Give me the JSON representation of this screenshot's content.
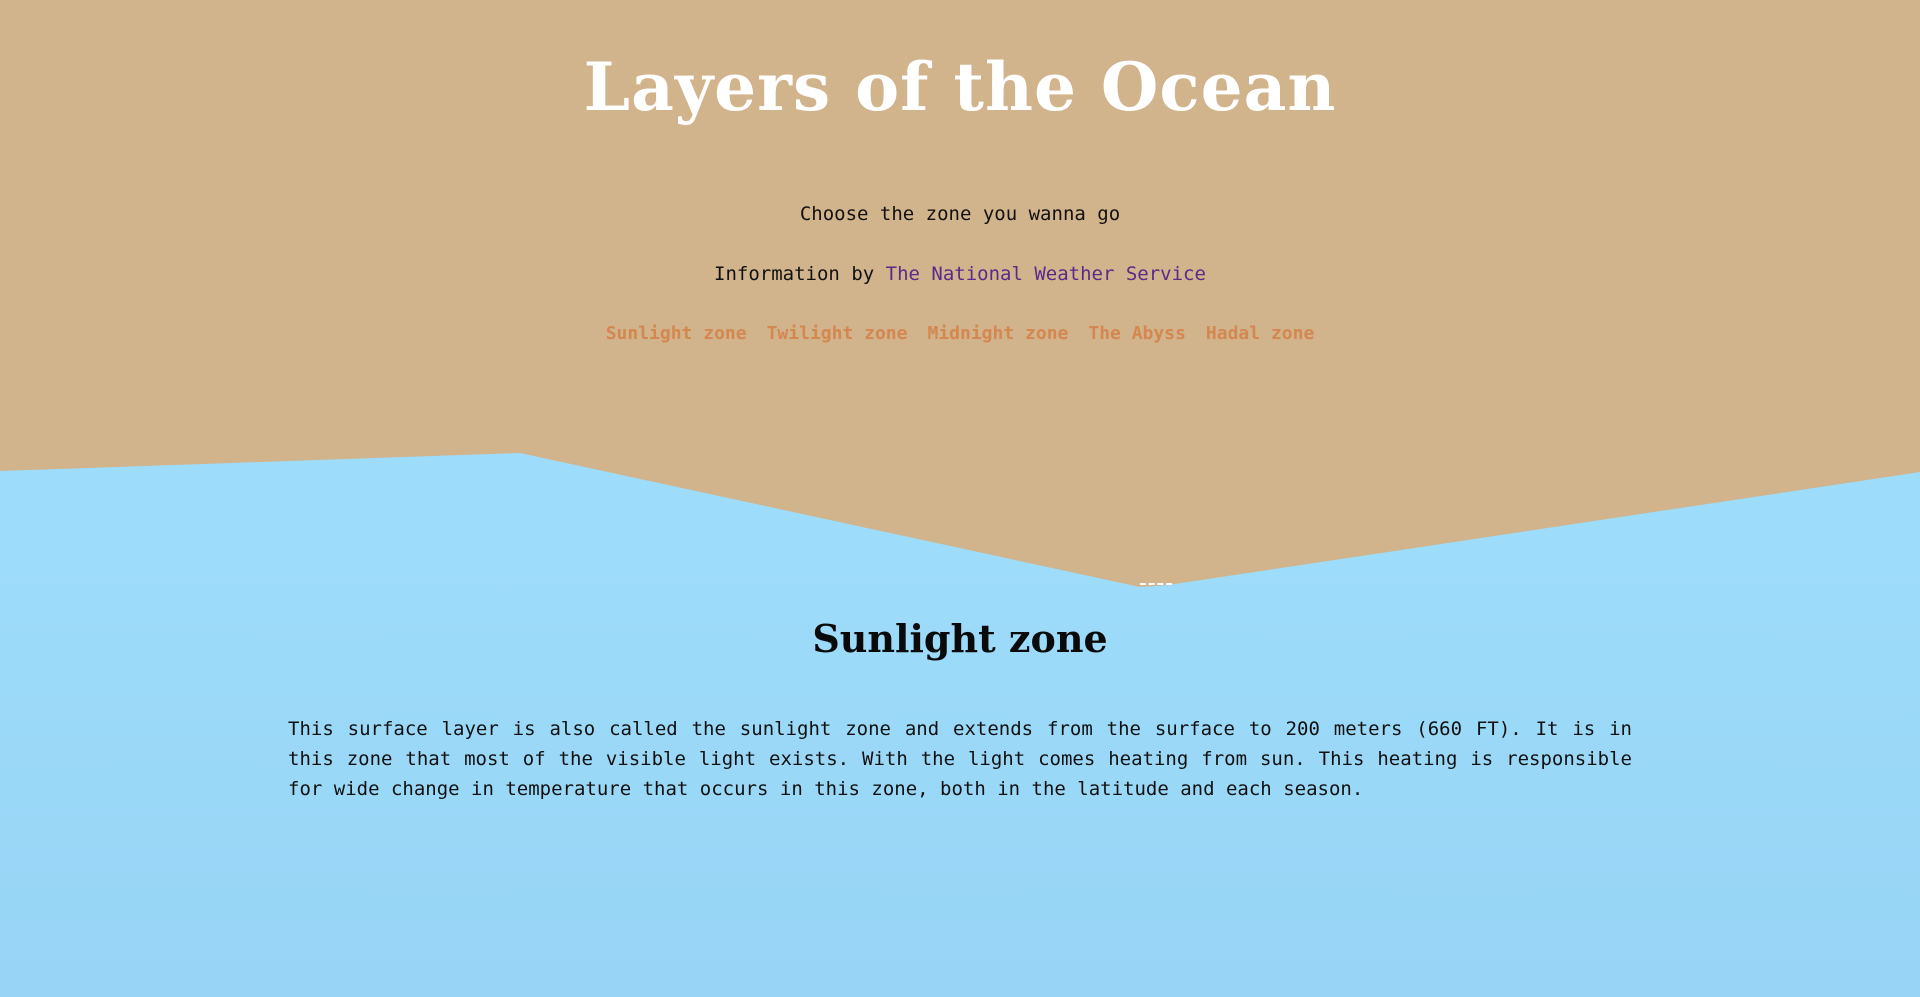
{
  "header": {
    "title": "Layers of the Ocean",
    "tagline": "Choose the zone you wanna go",
    "attribution_prefix": "Information by ",
    "attribution_link": "The National Weather Service"
  },
  "nav": {
    "items": [
      {
        "label": "Sunlight zone"
      },
      {
        "label": "Twilight zone"
      },
      {
        "label": "Midnight zone"
      },
      {
        "label": "The Abyss"
      },
      {
        "label": "Hadal zone"
      }
    ]
  },
  "section": {
    "title": "Sunlight zone",
    "body": "This surface layer is also called the sunlight zone and extends from the surface to 200 meters (660 FT). It is in this zone that most of the visible light exists. With the light comes heating from sun. This heating is responsible for wide change in temperature that occurs in this zone, both in the latitude and each season."
  },
  "colors": {
    "sand": "#d1b38c",
    "ocean": "#9edcfb",
    "title": "#ffffff",
    "nav_link": "#d4874f",
    "attribution_link": "#5a2a8a"
  }
}
